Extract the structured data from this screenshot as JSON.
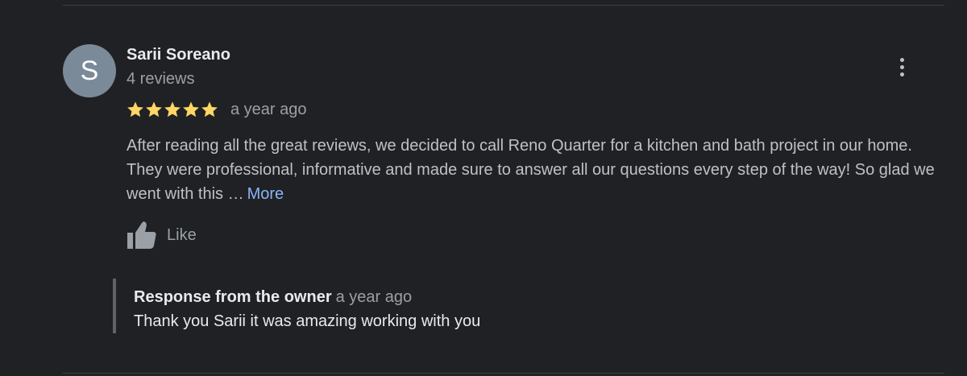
{
  "review": {
    "avatar_letter": "S",
    "avatar_color": "#7b8a98",
    "reviewer_name": "Sarii Soreano",
    "review_count": "4 reviews",
    "rating": 5,
    "rating_max": 5,
    "star_color": "#fdd663",
    "date": "a year ago",
    "text": "After reading all the great reviews, we decided to call Reno Quarter for a kitchen and bath project in our home. They were professional, informative and made sure to answer all our questions every step of the way! So glad we went with this …",
    "more_label": "More",
    "like_label": "Like",
    "like_icon": "thumbs-up-icon",
    "menu_icon": "more-vert-icon"
  },
  "owner_response": {
    "title": "Response from the owner",
    "date": "a year ago",
    "text": "Thank you Sarii it was amazing working with you"
  }
}
